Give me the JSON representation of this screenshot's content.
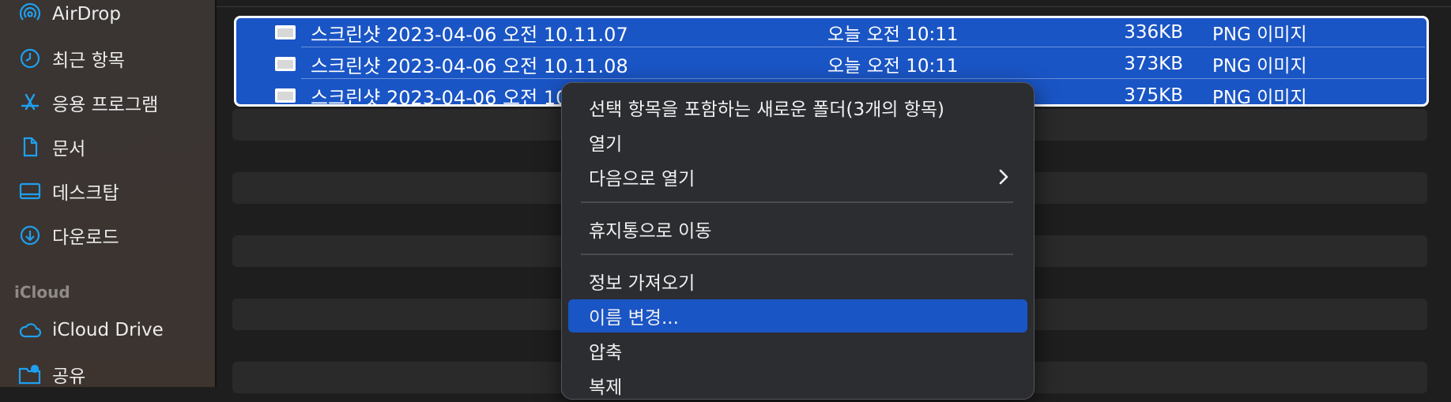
{
  "sidebar": {
    "items": [
      {
        "label": "AirDrop",
        "icon": "airdrop-icon"
      },
      {
        "label": "최근 항목",
        "icon": "clock-icon"
      },
      {
        "label": "응용 프로그램",
        "icon": "applications-icon"
      },
      {
        "label": "문서",
        "icon": "document-icon"
      },
      {
        "label": "데스크탑",
        "icon": "desktop-icon"
      },
      {
        "label": "다운로드",
        "icon": "download-icon"
      }
    ],
    "icloud_section": "iCloud",
    "icloud_items": [
      {
        "label": "iCloud Drive",
        "icon": "cloud-icon"
      },
      {
        "label": "공유",
        "icon": "shared-folder-icon"
      }
    ],
    "accent_color": "#1ea0f0"
  },
  "files": [
    {
      "name": "스크린샷 2023-04-06 오전 10.11.07",
      "date": "오늘 오전 10:11",
      "size": "336KB",
      "kind": "PNG 이미지"
    },
    {
      "name": "스크린샷 2023-04-06 오전 10.11.08",
      "date": "오늘 오전 10:11",
      "size": "373KB",
      "kind": "PNG 이미지"
    },
    {
      "name": "스크린샷 2023-04-06 오전 10",
      "date": "",
      "size": "375KB",
      "kind": "PNG 이미지"
    }
  ],
  "context_menu": {
    "items": [
      {
        "label": "선택 항목을 포함하는 새로운 폴더(3개의 항목)"
      },
      {
        "label": "열기"
      },
      {
        "label": "다음으로 열기",
        "submenu": true
      },
      {
        "label": "휴지통으로 이동"
      },
      {
        "label": "정보 가져오기"
      },
      {
        "label": "이름 변경...",
        "highlighted": true
      },
      {
        "label": "압축"
      },
      {
        "label": "복제"
      }
    ]
  },
  "colors": {
    "selection": "#1a55c5",
    "menu_bg": "#2b2d31"
  }
}
